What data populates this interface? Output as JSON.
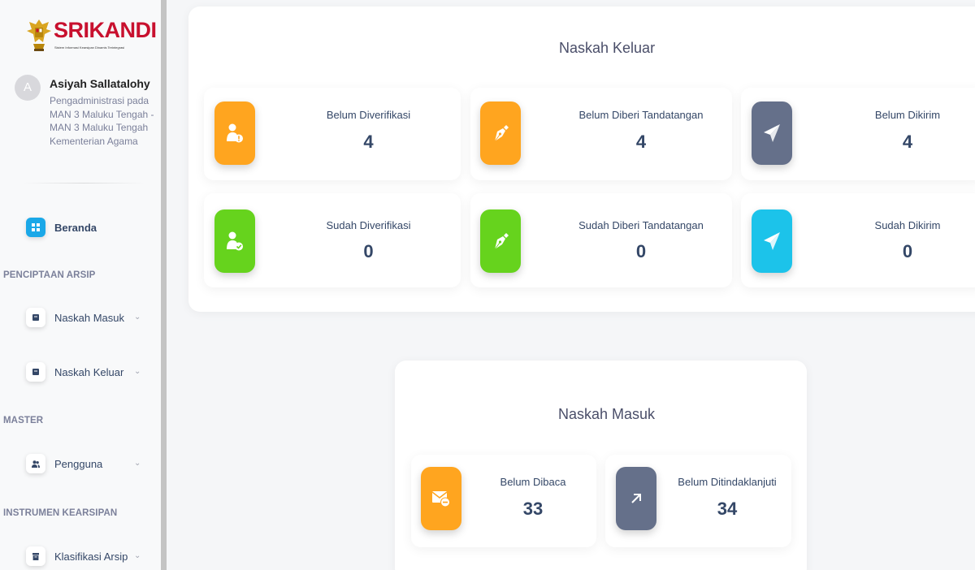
{
  "app": {
    "name": "SRIKANDI",
    "tagline": "Sistem Informasi Kearsipan Dinamis Terintegrasi"
  },
  "user": {
    "avatar_initial": "A",
    "name": "Asiyah Sallatalohy",
    "desc_line1": "Pengadministrasi pada",
    "desc_line2": "MAN 3 Maluku Tengah -",
    "desc_line3": "MAN 3 Maluku Tengah",
    "desc_line4": "Kementerian Agama"
  },
  "sidebar": {
    "home": {
      "label": "Beranda",
      "icon": "grid-icon"
    },
    "section_creation": "PENCIPTAAN ARSIP",
    "naskah_masuk": {
      "label": "Naskah Masuk",
      "icon": "document-icon"
    },
    "naskah_keluar": {
      "label": "Naskah Keluar",
      "icon": "document-icon"
    },
    "section_master": "MASTER",
    "pengguna": {
      "label": "Pengguna",
      "icon": "users-icon"
    },
    "section_instrument": "INSTRUMEN KEARSIPAN",
    "klasifikasi": {
      "label": "Klasifikasi Arsip",
      "icon": "archive-icon"
    },
    "chevron": "⌄"
  },
  "naskah_keluar": {
    "title": "Naskah Keluar",
    "cards": [
      {
        "label": "Belum Diverifikasi",
        "value": "4",
        "color": "#ffa51f",
        "icon": "user-pending-icon"
      },
      {
        "label": "Belum Diberi Tandatangan",
        "value": "4",
        "color": "#ffa51f",
        "icon": "pen-icon"
      },
      {
        "label": "Belum Dikirim",
        "value": "4",
        "color": "#65708a",
        "icon": "send-icon"
      },
      {
        "label": "Sudah Diverifikasi",
        "value": "0",
        "color": "#66d31d",
        "icon": "user-check-icon"
      },
      {
        "label": "Sudah Diberi Tandatangan",
        "value": "0",
        "color": "#66d31d",
        "icon": "pen-icon"
      },
      {
        "label": "Sudah Dikirim",
        "value": "0",
        "color": "#1cc3ea",
        "icon": "send-icon"
      }
    ]
  },
  "naskah_masuk": {
    "title": "Naskah Masuk",
    "cards": [
      {
        "label": "Belum Dibaca",
        "value": "33",
        "color": "#ffa51f",
        "icon": "mail-minus-icon"
      },
      {
        "label": "Belum Ditindaklanjuti",
        "value": "34",
        "color": "#65708a",
        "icon": "arrow-up-right-icon"
      }
    ]
  }
}
